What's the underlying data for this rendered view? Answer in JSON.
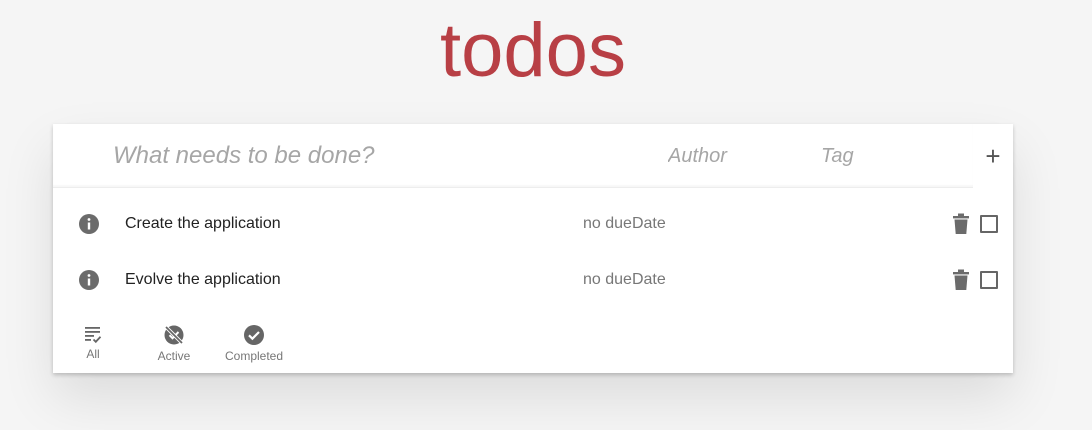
{
  "header": {
    "title": "todos",
    "title_color": "#b83f45"
  },
  "new_todo": {
    "title_placeholder": "What needs to be done?",
    "author_placeholder": "Author",
    "tag_placeholder": "Tag",
    "add_label": "+"
  },
  "todos": [
    {
      "title": "Create the application",
      "due": "no dueDate",
      "completed": false,
      "icon": "info-icon",
      "delete_icon": "trash-icon"
    },
    {
      "title": "Evolve the application",
      "due": "no dueDate",
      "completed": false,
      "icon": "info-icon",
      "delete_icon": "trash-icon"
    }
  ],
  "filters": [
    {
      "label": "All",
      "icon": "list-check-icon",
      "selected": true
    },
    {
      "label": "Active",
      "icon": "not-done-icon",
      "selected": false
    },
    {
      "label": "Completed",
      "icon": "check-circle-icon",
      "selected": false
    }
  ]
}
